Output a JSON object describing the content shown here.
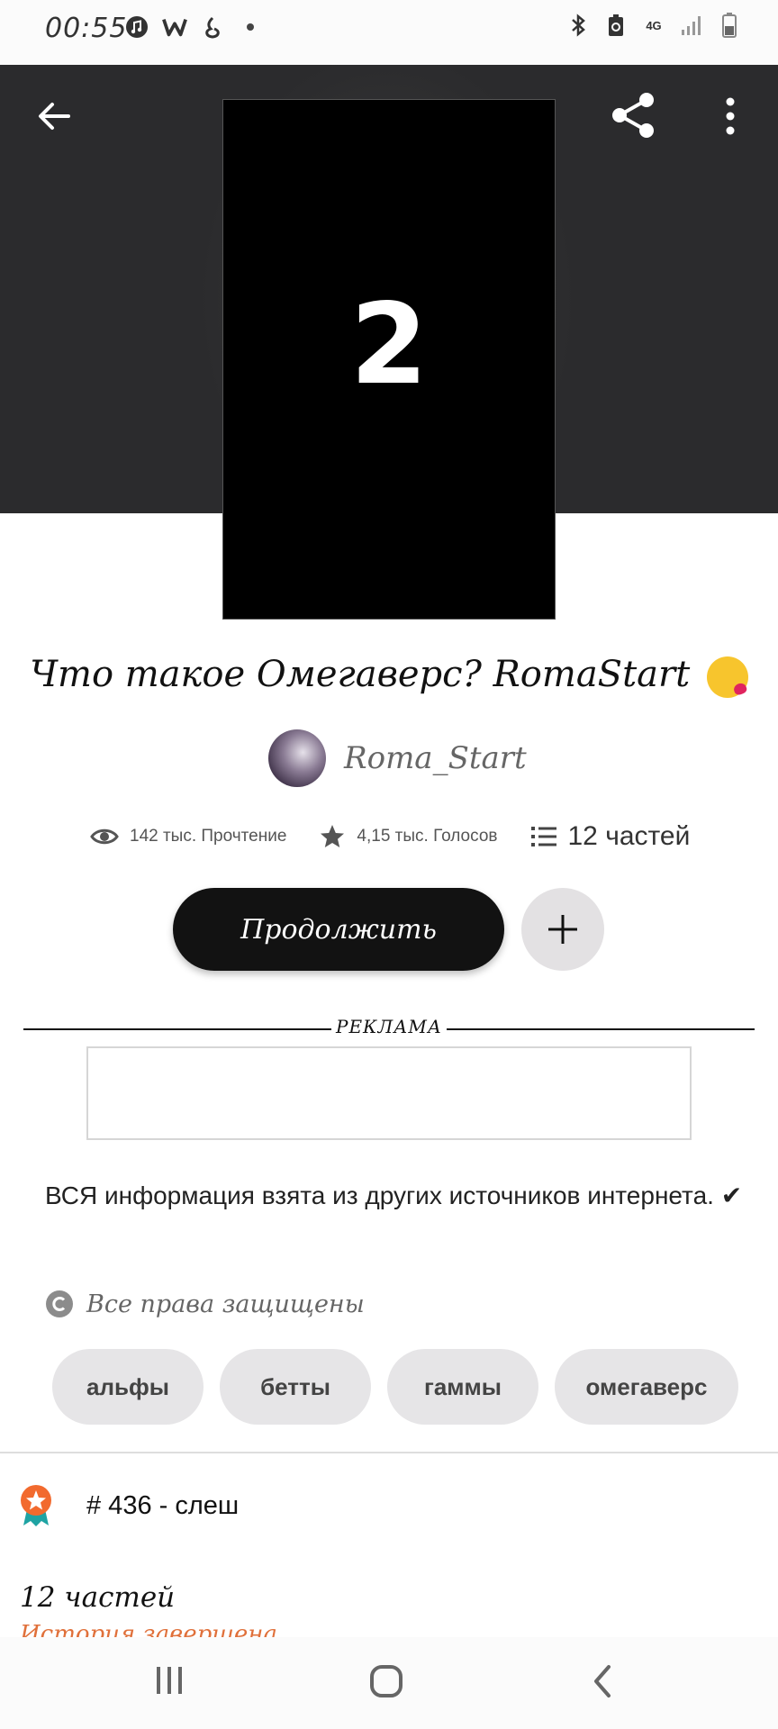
{
  "status_bar": {
    "time": "00:55",
    "network": "4G",
    "left_icons": [
      "music-icon",
      "w-app-icon",
      "notification-icon",
      "dot-icon"
    ],
    "right_icons": [
      "bluetooth-icon",
      "battery-saver-icon",
      "network-4g-icon",
      "signal-icon",
      "battery-icon"
    ]
  },
  "header": {
    "back_icon": "arrow-left-icon",
    "share_icon": "share-icon",
    "more_icon": "more-vertical-icon"
  },
  "cover": {
    "text": "2"
  },
  "story": {
    "title": "Что такое Омегаверс? RomaStart",
    "title_emoji": "kissing-face-emoji",
    "author": "Roma_Start",
    "reads": "142 тыс. Прочтение",
    "votes": "4,15 тыс. Голосов",
    "parts": "12 частей",
    "continue_label": "Продолжить",
    "add_icon": "plus-icon"
  },
  "ad": {
    "label": "РЕКЛАМА"
  },
  "description": "ВСЯ информация взята из других источников интернета. ✔",
  "rights": "Все права защищены",
  "tags": [
    "альфы",
    "бетты",
    "гаммы",
    "омегаверс"
  ],
  "rank": {
    "text": "# 436 - слеш",
    "badge_color": "#f26a2e"
  },
  "parts_section": {
    "title": "12 частей",
    "status": "История завершена"
  },
  "nav": {
    "recent_icon": "recent-apps-icon",
    "home_icon": "home-icon",
    "back_icon": "back-icon"
  },
  "colors": {
    "hero_bg": "#2b2b2d",
    "button_dark": "#121212",
    "tag_bg": "#e6e5e7",
    "accent_orange": "#e0703a"
  }
}
